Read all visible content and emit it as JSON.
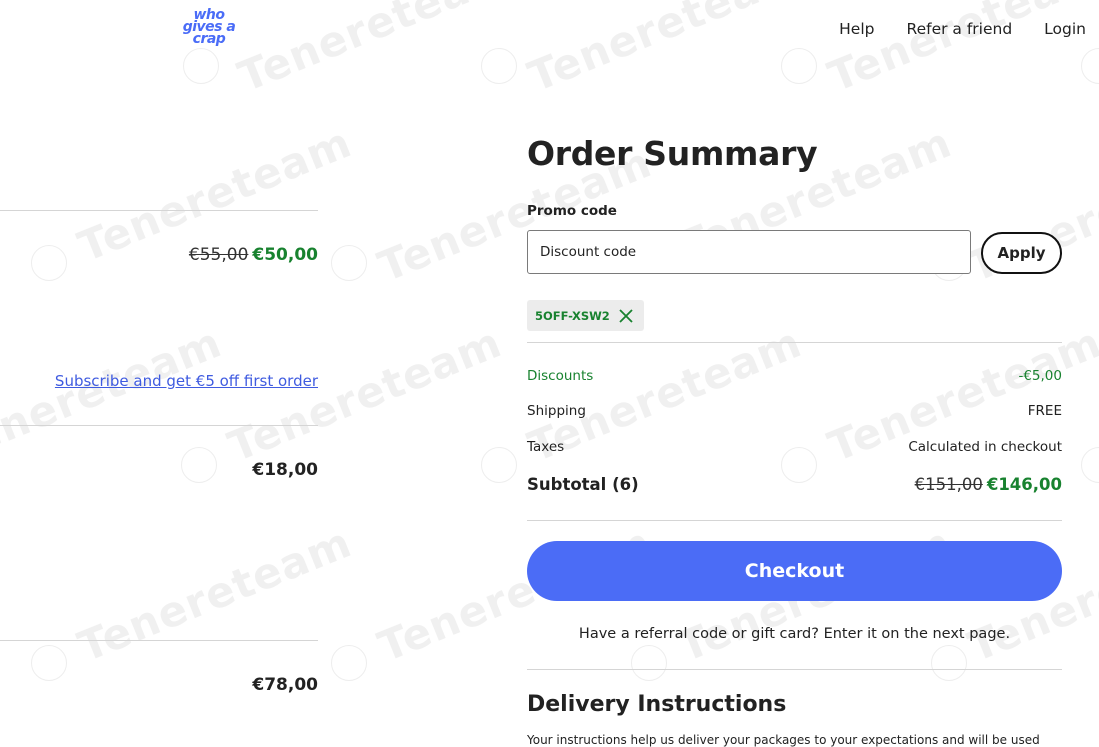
{
  "header": {
    "logo_lines": [
      "who",
      "gives a",
      "crap"
    ],
    "nav": [
      "Help",
      "Refer a friend",
      "Login"
    ]
  },
  "left": {
    "item1": {
      "original": "€55,00",
      "sale": "€50,00"
    },
    "subscribe_link": "Subscribe and get €5 off first order",
    "item2": {
      "price": "€18,00"
    },
    "item3": {
      "price": "€78,00"
    }
  },
  "summary": {
    "title": "Order Summary",
    "promo_label": "Promo code",
    "promo_placeholder": "Discount code",
    "apply_label": "Apply",
    "applied_code": "5OFF-XSW2",
    "rows": [
      {
        "label": "Discounts",
        "value": "-€5,00"
      },
      {
        "label": "Shipping",
        "value": "FREE"
      },
      {
        "label": "Taxes",
        "value": "Calculated in checkout"
      }
    ],
    "subtotal_label": "Subtotal (6)",
    "subtotal_original": "€151,00",
    "subtotal_final": "€146,00",
    "checkout_label": "Checkout",
    "referral_text": "Have a referral code or gift card? Enter it on the next page.",
    "delivery_title": "Delivery Instructions",
    "delivery_text": "Your instructions help us deliver your packages to your expectations and will be used"
  },
  "watermark": "Tenereteam",
  "colors": {
    "accent": "#4b6cf6",
    "green": "#18822f",
    "logo": "#4a6cf7"
  }
}
